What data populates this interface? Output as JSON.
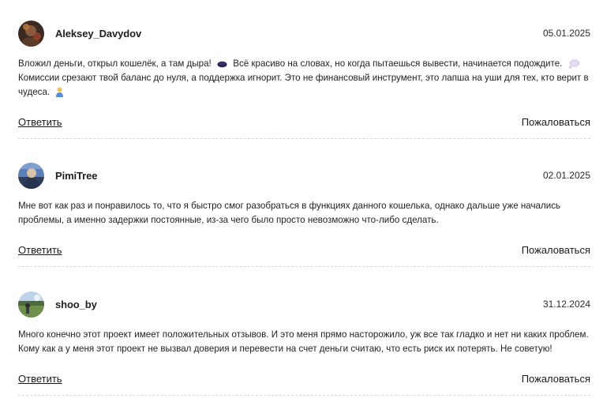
{
  "comments": [
    {
      "author": "Aleksey_Davydov",
      "date": "05.01.2025",
      "text_part1": "Вложил деньги, открыл кошелёк, а там дыра!",
      "text_part2": "Всё красиво на словах, но когда пытаешься вывести, начинается подождите.",
      "text_part3": "Комиссии срезают твой баланс до нуля, а поддержка игнорит. Это не финансовый инструмент, это лапша на уши для тех, кто верит в чудеса.",
      "reply_label": "Ответить",
      "report_label": "Пожаловаться"
    },
    {
      "author": "PimiTree",
      "date": "02.01.2025",
      "text": "Мне вот как раз и понравилось то, что я быстро смог разобраться в функциях данного кошелька, однако дальше уже начались проблемы, а именно задержки постоянные, из-за чего было просто невозможно что-либо сделать.",
      "reply_label": "Ответить",
      "report_label": "Пожаловаться"
    },
    {
      "author": "shoo_by",
      "date": "31.12.2024",
      "text": "Много конечно этот проект имеет положительных отзывов. И это меня прямо насторожило, уж все так гладко и нет ни каких проблем. Кому как а у меня этот проект не вызвал доверия и перевести на счет деньги считаю, что есть риск их потерять. Не советую!",
      "reply_label": "Ответить",
      "report_label": "Пожаловаться"
    }
  ],
  "icons": {
    "emoji_1": "hole-emoji",
    "emoji_2": "thought-balloon-emoji",
    "emoji_3": "person-emoji"
  }
}
